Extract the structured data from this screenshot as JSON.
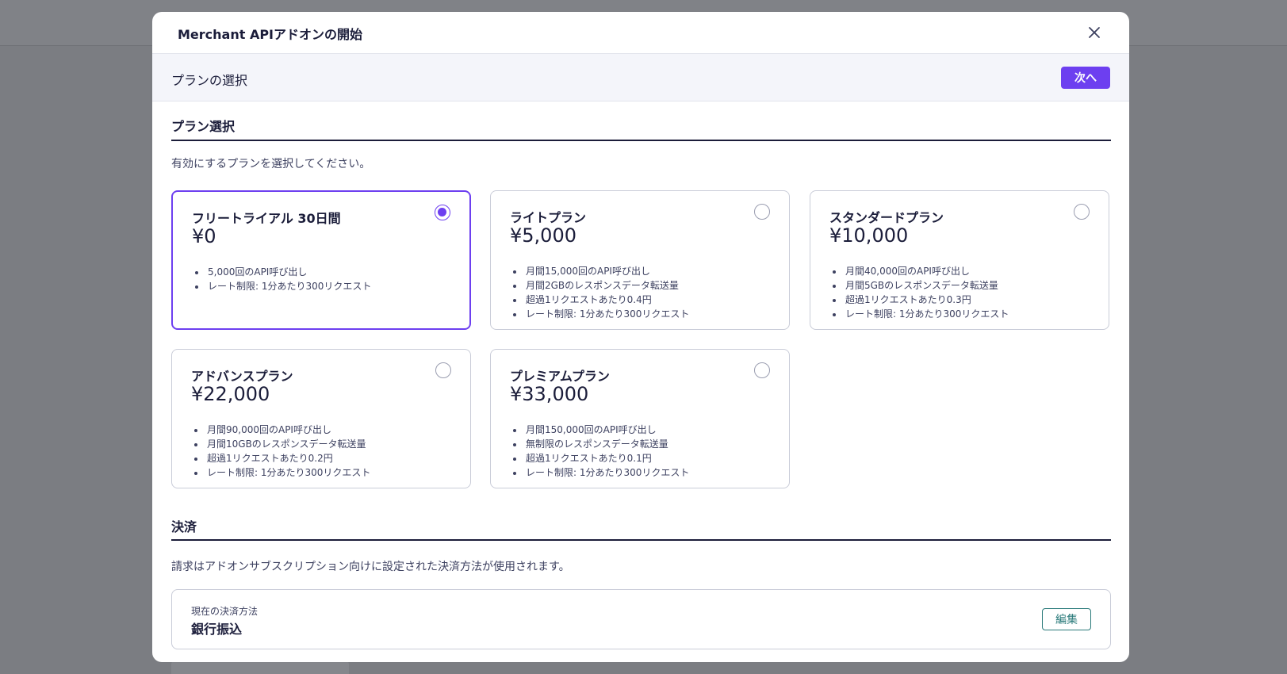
{
  "modal": {
    "title": "Merchant APIアドオンの開始",
    "step_label": "プランの選択",
    "next_label": "次へ"
  },
  "plan_section": {
    "title": "プラン選択",
    "description": "有効にするプランを選択してください。",
    "selected_index": 0,
    "plans": [
      {
        "name": "フリートライアル 30日間",
        "price": "¥0",
        "features": [
          "5,000回のAPI呼び出し",
          "レート制限: 1分あたり300リクエスト"
        ]
      },
      {
        "name": "ライトプラン",
        "price": "¥5,000",
        "features": [
          "月間15,000回のAPI呼び出し",
          "月間2GBのレスポンスデータ転送量",
          "超過1リクエストあたり0.4円",
          "レート制限: 1分あたり300リクエスト"
        ]
      },
      {
        "name": "スタンダードプラン",
        "price": "¥10,000",
        "features": [
          "月間40,000回のAPI呼び出し",
          "月間5GBのレスポンスデータ転送量",
          "超過1リクエストあたり0.3円",
          "レート制限: 1分あたり300リクエスト"
        ]
      },
      {
        "name": "アドバンスプラン",
        "price": "¥22,000",
        "features": [
          "月間90,000回のAPI呼び出し",
          "月間10GBのレスポンスデータ転送量",
          "超過1リクエストあたり0.2円",
          "レート制限: 1分あたり300リクエスト"
        ]
      },
      {
        "name": "プレミアムプラン",
        "price": "¥33,000",
        "features": [
          "月間150,000回のAPI呼び出し",
          "無制限のレスポンスデータ転送量",
          "超過1リクエストあたり0.1円",
          "レート制限: 1分あたり300リクエスト"
        ]
      }
    ]
  },
  "payment_section": {
    "title": "決済",
    "description": "請求はアドオンサブスクリプション向けに設定された決済方法が使用されます。",
    "caption": "現在の決済方法",
    "method": "銀行振込",
    "edit_label": "編集"
  },
  "colors": {
    "accent": "#6d3ff0",
    "edit": "#2a7a7a",
    "text": "#1b1d3a",
    "overlay": "#7b7d82"
  },
  "icons": {
    "close": "close-icon"
  }
}
